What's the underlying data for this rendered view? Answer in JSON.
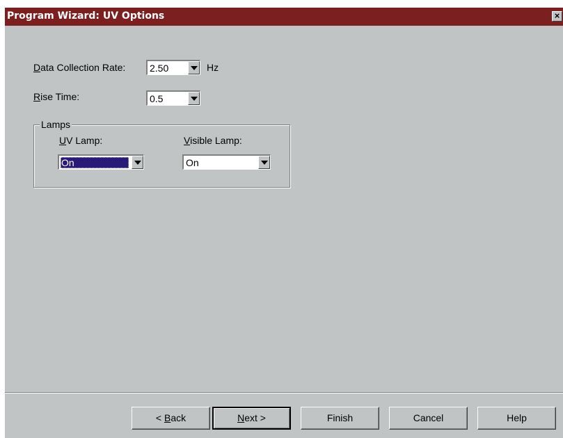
{
  "window": {
    "title": "Program Wizard: UV Options",
    "close_label": "×"
  },
  "form": {
    "data_rate": {
      "mnemonic": "D",
      "label_rest": "ata Collection Rate:",
      "value": "2.50",
      "unit": "Hz"
    },
    "rise_time": {
      "mnemonic": "R",
      "label_rest": "ise Time:",
      "value": "0.5"
    },
    "lamps": {
      "title": "Lamps",
      "uv": {
        "mnemonic": "U",
        "label_rest": "V Lamp:",
        "value": "On"
      },
      "visible": {
        "mnemonic": "V",
        "label_rest": "isible Lamp:",
        "value": "On"
      }
    }
  },
  "buttons": {
    "back": {
      "prefix": "< ",
      "mnemonic": "B",
      "rest": "ack"
    },
    "next": {
      "mnemonic": "N",
      "rest": "ext >"
    },
    "finish": "Finish",
    "cancel": "Cancel",
    "help": "Help"
  },
  "colors": {
    "titlebar": "#7b1f20",
    "face": "#c0c4c4",
    "selection": "#2a1a78"
  }
}
